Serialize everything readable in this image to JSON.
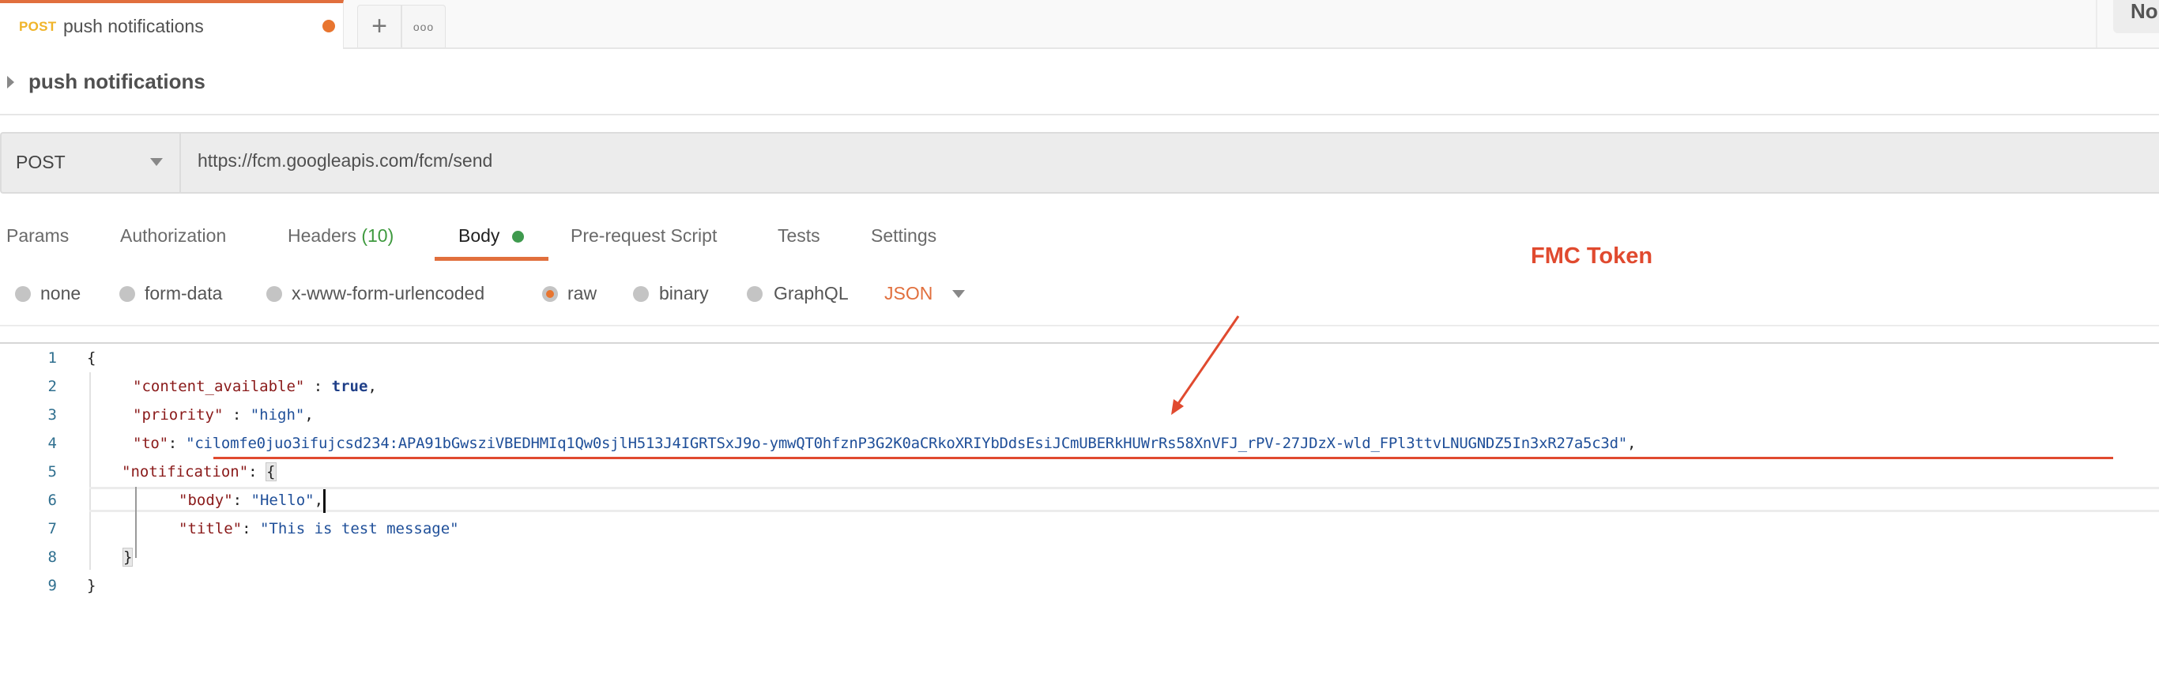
{
  "tab": {
    "method": "POST",
    "title": "push notifications",
    "unsaved_dot_color": "#e8752f",
    "add_icon": "+",
    "more_icon": "ooo"
  },
  "top_right_button": "No",
  "collection": {
    "title": "push notifications"
  },
  "request": {
    "method": "POST",
    "url": "https://fcm.googleapis.com/fcm/send"
  },
  "request_tabs": [
    {
      "label": "Params"
    },
    {
      "label": "Authorization"
    },
    {
      "label": "Headers",
      "count": "(10)"
    },
    {
      "label": "Body",
      "active": true
    },
    {
      "label": "Pre-request Script"
    },
    {
      "label": "Tests"
    },
    {
      "label": "Settings"
    }
  ],
  "body_types": [
    {
      "label": "none"
    },
    {
      "label": "form-data"
    },
    {
      "label": "x-www-form-urlencoded"
    },
    {
      "label": "raw",
      "selected": true
    },
    {
      "label": "binary"
    },
    {
      "label": "GraphQL"
    }
  ],
  "raw_language": "JSON",
  "editor": {
    "line_numbers": [
      "1",
      "2",
      "3",
      "4",
      "5",
      "6",
      "7",
      "8",
      "9"
    ],
    "lines": {
      "l1_open": "{",
      "l2_key": "\"content_available\"",
      "l2_sep": " : ",
      "l2_val": "true",
      "l2_end": ",",
      "l3_key": "\"priority\"",
      "l3_sep": " : ",
      "l3_val": "\"high\"",
      "l3_end": ",",
      "l4_key": "\"to\"",
      "l4_sep": ": ",
      "l4_val": "\"cilomfe0juo3ifujcsd234:APA91bGwsziVBEDHMIq1Qw0sjlH513J4IGRTSxJ9o-ymwQT0hfznP3G2K0aCRkoXRIYbDdsEsiJCmUBERkHUWrRs58XnVFJ_rPV-27JDzX-wld_FPl3ttvLNUGNDZ5In3xR27a5c3d\"",
      "l4_end": ",",
      "l5_key": "\"notification\"",
      "l5_sep": ": ",
      "l5_open": "{",
      "l6_key": "\"body\"",
      "l6_sep": ": ",
      "l6_val": "\"Hello\"",
      "l6_end": ",",
      "l7_key": "\"title\"",
      "l7_sep": ": ",
      "l7_val": "\"This is test message\"",
      "l8_close": "}",
      "l9_close": "}"
    }
  },
  "annotation": {
    "label": "FMC Token",
    "color": "#e04a2f"
  }
}
